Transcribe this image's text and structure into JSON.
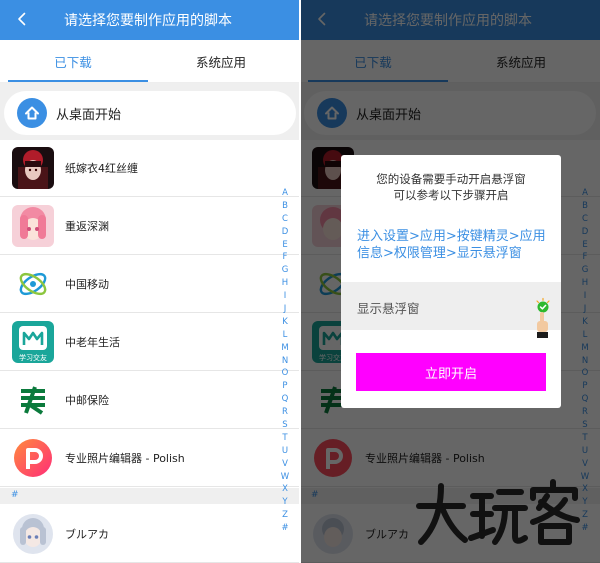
{
  "colors": {
    "accent": "#3b8fe3",
    "dialog_button": "#ff00ff",
    "checkmark": "#2eb82e"
  },
  "header": {
    "back_icon": "chevron-left-icon",
    "title": "请选择您要制作应用的脚本"
  },
  "tabs": [
    {
      "label": "已下载",
      "selected": true
    },
    {
      "label": "系统应用",
      "selected": false
    }
  ],
  "home_entry": {
    "icon": "home-icon",
    "label": "从桌面开始"
  },
  "apps": [
    {
      "name": "纸嫁衣4红丝缠",
      "icon": "game-art-icon"
    },
    {
      "name": "重返深渊",
      "icon": "anime-girl-icon"
    },
    {
      "name": "中国移动",
      "icon": "china-mobile-icon"
    },
    {
      "name": "中老年生活",
      "icon": "elderly-life-icon",
      "icon_caption": "学习交友"
    },
    {
      "name": "中邮保险",
      "icon": "china-post-icon"
    },
    {
      "name": "专业照片编辑器 - Polish",
      "icon": "polish-icon"
    }
  ],
  "section_hash": "#",
  "hash_apps": [
    {
      "name": "ブルアカ",
      "icon": "anime-avatar-icon"
    }
  ],
  "alphabet_index": [
    "A",
    "B",
    "C",
    "D",
    "E",
    "F",
    "G",
    "H",
    "I",
    "J",
    "K",
    "L",
    "M",
    "N",
    "O",
    "P",
    "Q",
    "R",
    "S",
    "T",
    "U",
    "V",
    "W",
    "X",
    "Y",
    "Z",
    "#"
  ],
  "dialog": {
    "line1": "您的设备需要手动开启悬浮窗",
    "line2": "可以参考以下步骤开启",
    "steps_line1": "进入设置>应用>按键精灵>应用",
    "steps_line2": "信息>权限管理>显示悬浮窗",
    "demo_label": "显示悬浮窗",
    "demo_icon": "green-check-icon",
    "tap_icon": "finger-tap-icon",
    "button_label": "立即开启"
  },
  "watermark": {
    "text": "大玩客"
  }
}
